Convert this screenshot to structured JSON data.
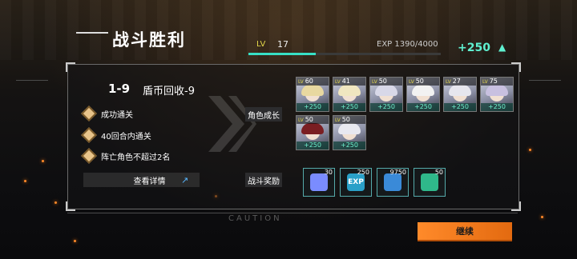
{
  "header": {
    "title": "战斗胜利",
    "player_level_label": "LV",
    "player_level": "17",
    "exp_text": "EXP 1390/4000",
    "exp_progress": 0.35,
    "exp_gain": "+250",
    "exp_gain_icon": "up-arrow-icon"
  },
  "stage": {
    "number": "1-9",
    "name": "盾币回收-9"
  },
  "objectives": [
    {
      "text": "成功通关",
      "icon": "diamond-icon"
    },
    {
      "text": "40回合内通关",
      "icon": "diamond-icon"
    },
    {
      "text": "阵亡角色不超过2名",
      "icon": "diamond-icon"
    }
  ],
  "details_button": {
    "label": "查看详情",
    "icon": "trend-chart-icon"
  },
  "character_growth": {
    "label": "角色成长",
    "level_prefix": "LV",
    "characters": [
      {
        "level": "60",
        "gain": "+250",
        "hair": "#e8d8a0"
      },
      {
        "level": "41",
        "gain": "+250",
        "hair": "#f0e6c0"
      },
      {
        "level": "50",
        "gain": "+250",
        "hair": "#d8d8e8"
      },
      {
        "level": "50",
        "gain": "+250",
        "hair": "#f2f2f2"
      },
      {
        "level": "27",
        "gain": "+250",
        "hair": "#e6e6ee"
      },
      {
        "level": "75",
        "gain": "+250",
        "hair": "#c8c0e0"
      },
      {
        "level": "50",
        "gain": "+250",
        "hair": "#7a1e22"
      },
      {
        "level": "50",
        "gain": "+250",
        "hair": "#e8e8f0"
      }
    ]
  },
  "battle_rewards": {
    "label": "战斗奖励",
    "items": [
      {
        "icon": "cube-icon",
        "count": "30",
        "color": "#7a8cff"
      },
      {
        "icon": "exp-icon",
        "count": "250",
        "color": "#2aa0c8",
        "text": "EXP"
      },
      {
        "icon": "ticket-icon",
        "count": "9750",
        "color": "#3a8ad8"
      },
      {
        "icon": "medal-icon",
        "count": "50",
        "color": "#2fb88a"
      }
    ]
  },
  "continue_button": {
    "label": "继续"
  },
  "colors": {
    "accent": "#37e0c6",
    "button": "#ff8a2a",
    "level": "#e4d84a"
  }
}
